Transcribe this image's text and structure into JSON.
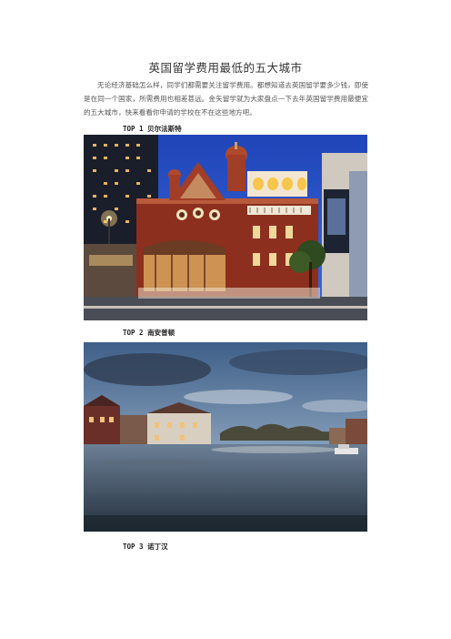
{
  "document": {
    "title": "英国留学费用最低的五大城市",
    "intro": "无论经济基础怎么样，同学们都需要关注留学费用。都想知道去英国留学要多少钱，即使是在同一个国家，所需费用也相差甚远。金矢留学就为大家盘点一下去年英国留学费用最便宜的五大城市，快来看看你申请的学校在不在这些地方吧。",
    "sections": [
      {
        "heading": "TOP 1 贝尔法斯特",
        "image": "belfast-grand-opera-house-photo"
      },
      {
        "heading": "TOP 2 南安普顿",
        "image": "southampton-river-photo"
      },
      {
        "heading": "TOP 3 诺丁汉"
      }
    ]
  }
}
